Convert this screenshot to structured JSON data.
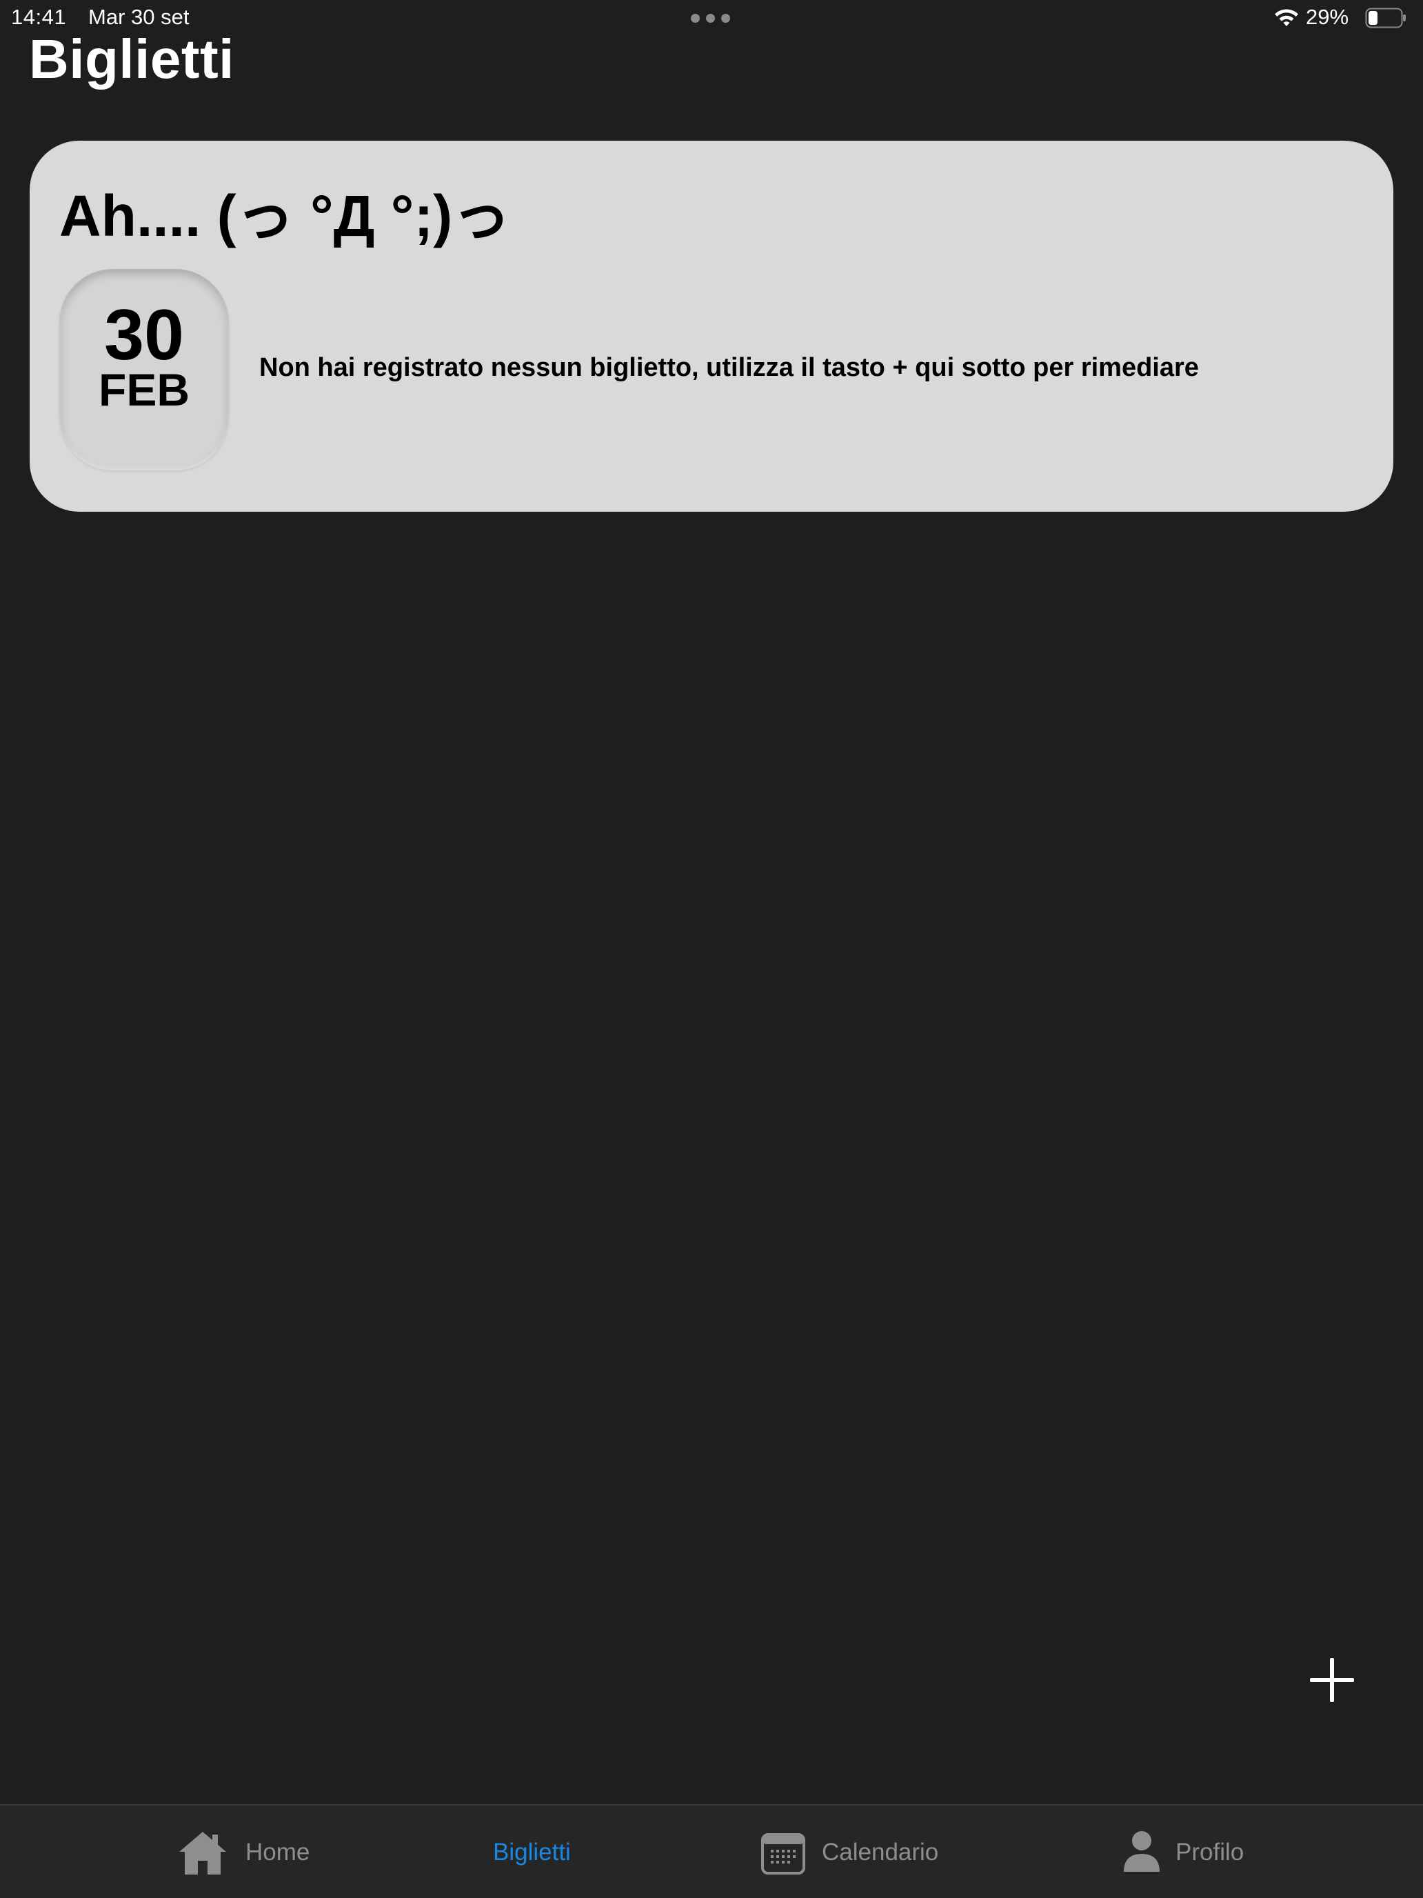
{
  "status_bar": {
    "time": "14:41",
    "date": "Mar 30 set",
    "battery_percent": "29%",
    "battery_level": 0.29,
    "wifi_icon": "wifi-icon",
    "battery_icon": "battery-icon"
  },
  "page": {
    "title": "Biglietti"
  },
  "empty_card": {
    "heading": "Ah.... (っ °Д °;)っ",
    "date_day": "30",
    "date_month": "FEB",
    "message": "Non hai registrato nessun biglietto, utilizza il tasto + qui sotto per rimediare"
  },
  "add_button": {
    "icon": "plus-icon"
  },
  "tab_bar": {
    "active_color": "#1a87e6",
    "inactive_color": "#8e8e8e",
    "tabs": [
      {
        "label": "Home",
        "icon": "home-icon",
        "active": false
      },
      {
        "label": "Biglietti",
        "icon": null,
        "active": true
      },
      {
        "label": "Calendario",
        "icon": "calendar-icon",
        "active": false
      },
      {
        "label": "Profilo",
        "icon": "person-icon",
        "active": false
      }
    ]
  }
}
